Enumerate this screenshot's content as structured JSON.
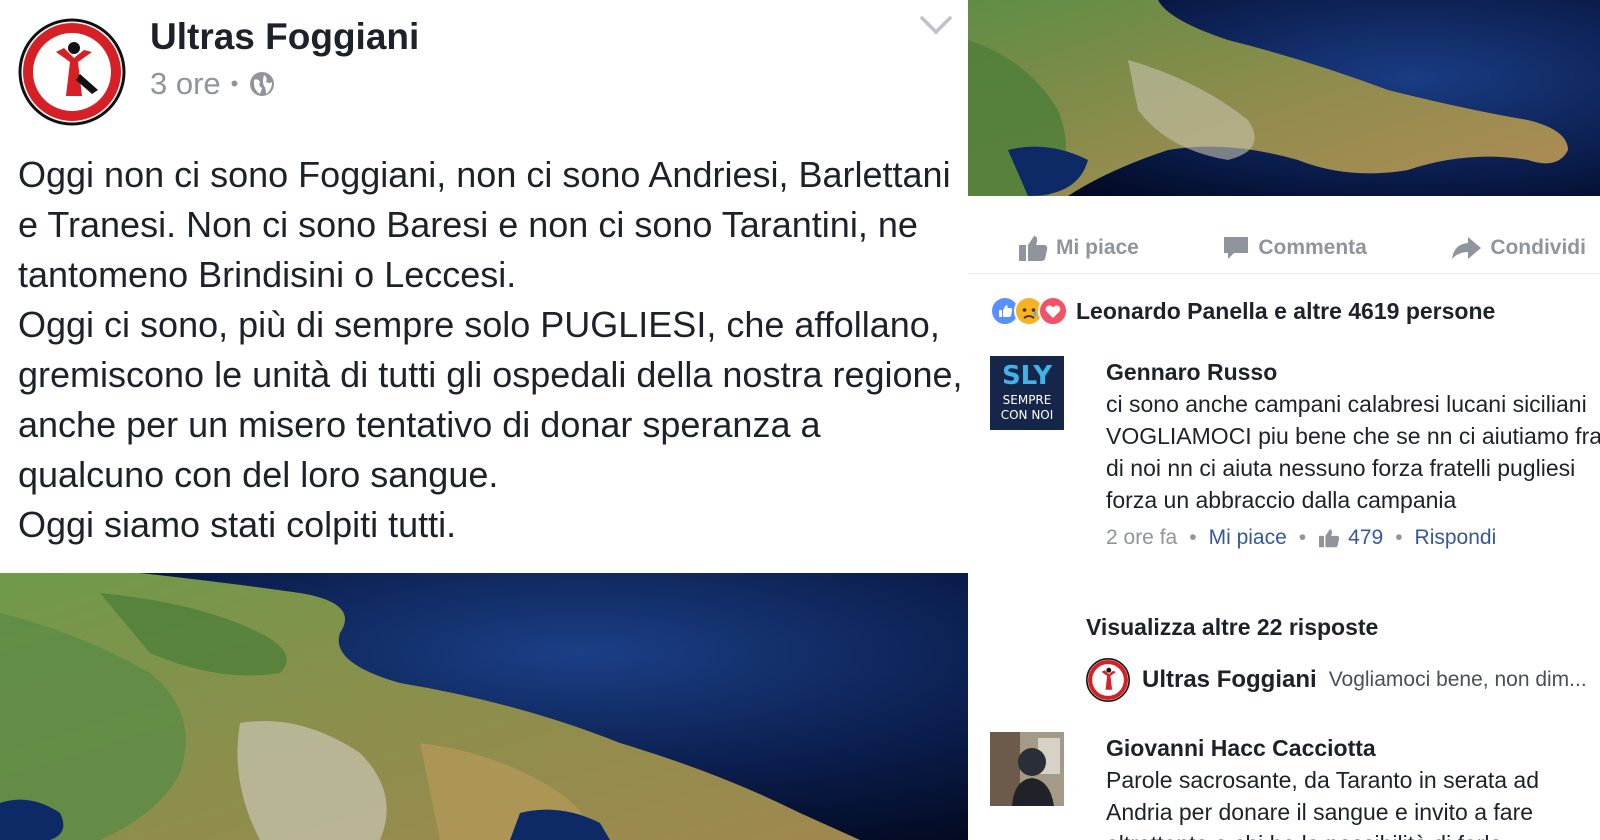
{
  "post": {
    "author": "Ultras Foggiani",
    "time": "3 ore",
    "separator": "•",
    "icon_privacy": "globe-icon",
    "paragraphs": [
      "Oggi non ci sono Foggiani, non ci sono Andriesi, Barlettani e Tranesi. Non ci sono Baresi e non ci sono Tarantini, ne tantomeno Brindisini o Leccesi.",
      "Oggi ci sono, più di sempre solo PUGLIESI, che affollano, gremiscono le unità di tutti gli ospedali della nostra regione, anche per un misero tentativo di donar speranza a qualcuno con del loro sangue.",
      "Oggi siamo stati colpiti tutti."
    ]
  },
  "actions": {
    "like": "Mi piace",
    "comment": "Commenta",
    "share": "Condividi"
  },
  "reactions": {
    "summary": "Leonardo Panella e altre 4619 persone",
    "icons": [
      "like-icon",
      "sad-icon",
      "love-icon"
    ]
  },
  "comments": [
    {
      "name": "Gennaro Russo",
      "text": "ci sono anche campani calabresi lucani siciliani VOGLIAMOCI piu bene che se nn ci aiutiamo fra di noi nn ci aiuta nessuno forza fratelli pugliesi forza un abbraccio dalla campania",
      "time": "2 ore fa",
      "like_label": "Mi piace",
      "likes": "479",
      "reply_label": "Rispondi",
      "avatar_lines": [
        "SLY",
        "SEMPRE",
        "CON NOI"
      ]
    },
    {
      "name": "Giovanni Hacc Cacciotta",
      "text": "Parole sacrosante, da Taranto in serata ad Andria per donare il sangue e invito a fare altrettanto a chi ha la possibilità di farlo"
    }
  ],
  "more_replies": "Visualizza altre 22 risposte",
  "reply_preview": {
    "name": "Ultras Foggiani",
    "text": "Vogliamoci bene, non dim..."
  },
  "colors": {
    "link": "#365899",
    "meta": "#90949c",
    "text": "#1d2129",
    "like_blue": "#5890ff",
    "love_red": "#f25268",
    "sad_yellow": "#f7b125"
  }
}
